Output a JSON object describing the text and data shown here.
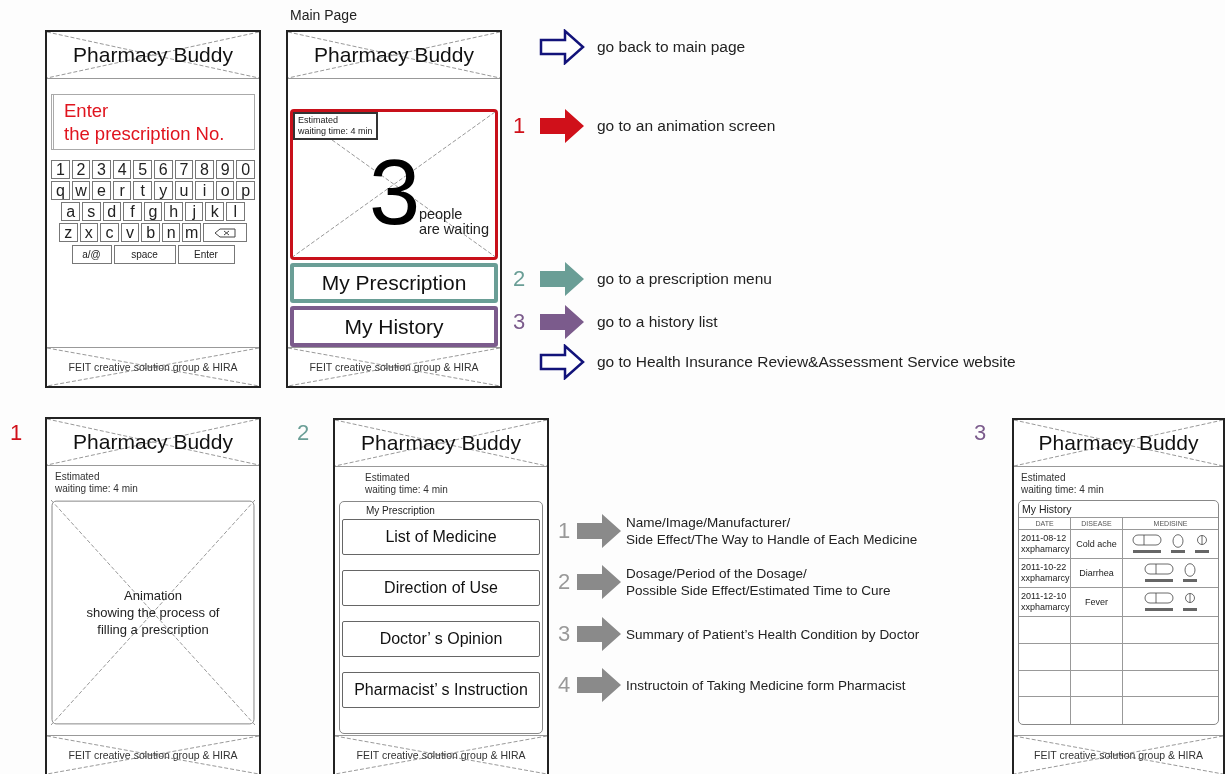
{
  "main_page_label": "Main Page",
  "input_screen": {
    "title": "Pharmacy Buddy",
    "placeholder": "Enter\nthe prescription No.",
    "keyboard": {
      "rows": [
        [
          "1",
          "2",
          "3",
          "4",
          "5",
          "6",
          "7",
          "8",
          "9",
          "0"
        ],
        [
          "q",
          "w",
          "e",
          "r",
          "t",
          "y",
          "u",
          "i",
          "o",
          "p"
        ],
        [
          "a",
          "s",
          "d",
          "f",
          "g",
          "h",
          "j",
          "k",
          "l"
        ],
        [
          "z",
          "x",
          "c",
          "v",
          "b",
          "n",
          "m"
        ]
      ],
      "backspace": true,
      "function_keys": [
        "a/@",
        "space",
        "Enter"
      ]
    },
    "footer": "FEIT creative solution group & HIRA"
  },
  "main_screen": {
    "title": "Pharmacy Buddy",
    "waiting_badge": "Estimated\nwaiting time: 4 min",
    "people_count": "3",
    "people_label": "people\nare waiting",
    "menu": [
      {
        "label": "My Prescription",
        "color": "#6a9e96"
      },
      {
        "label": "My History",
        "color": "#7b5b8c"
      }
    ],
    "footer": "FEIT creative solution group & HIRA"
  },
  "transitions": [
    {
      "kind": "outline",
      "text": "go back to main page"
    },
    {
      "kind": "filled",
      "number": "1",
      "color": "#d0101a",
      "text": "go to an animation screen"
    },
    {
      "kind": "filled",
      "number": "2",
      "color": "#6a9e96",
      "text": "go to a prescription menu"
    },
    {
      "kind": "filled",
      "number": "3",
      "color": "#7b5b8c",
      "text": "go to a history list"
    },
    {
      "kind": "outline",
      "text": "go to Health Insurance Review&Assessment Service website"
    }
  ],
  "section_markers": [
    {
      "label": "1",
      "color": "#d0101a"
    },
    {
      "label": "2",
      "color": "#6a9e96"
    },
    {
      "label": "3",
      "color": "#7b5b8c"
    }
  ],
  "animation_screen": {
    "title": "Pharmacy Buddy",
    "waiting": "Estimated\nwaiting time: 4 min",
    "animation_caption": "Animation\nshowing the process of\nfilling a prescription",
    "footer": "FEIT creative solution group & HIRA"
  },
  "prescription_screen": {
    "title": "Pharmacy Buddy",
    "waiting": "Estimated\nwaiting time: 4 min",
    "section_label": "My Prescription",
    "buttons": [
      "List of Medicine",
      "Direction of Use",
      "Doctor’ s Opinion",
      "Pharmacist’ s Instruction"
    ],
    "footer": "FEIT creative solution group & HIRA"
  },
  "prescription_notes": [
    {
      "number": "1",
      "text": "Name/Image/Manufacturer/\nSide Effect/The Way to Handle of Each Medicine"
    },
    {
      "number": "2",
      "text": "Dosage/Period of the Dosage/\nPossible Side Effect/Estimated Time to Cure"
    },
    {
      "number": "3",
      "text": "Summary of Patient’s Health Condition by Doctor"
    },
    {
      "number": "4",
      "text": "Instructoin of Taking Medicine form Pharmacist"
    }
  ],
  "history_screen": {
    "title": "Pharmacy Buddy",
    "waiting": "Estimated\nwaiting time: 4 min",
    "section_label": "My History",
    "columns": [
      "DATE",
      "DISEASE",
      "MEDISINE"
    ],
    "rows": [
      {
        "date": "2011-08-12",
        "pharmacy": "xxphamarcy",
        "disease": "Cold ache",
        "medicines": [
          {
            "kind": "capsule"
          },
          {
            "kind": "oval"
          },
          {
            "kind": "round"
          }
        ]
      },
      {
        "date": "2011-10-22",
        "pharmacy": "xxphamarcy",
        "disease": "Diarrhea",
        "medicines": [
          {
            "kind": "capsule"
          },
          {
            "kind": "oval"
          }
        ]
      },
      {
        "date": "2011-12-10",
        "pharmacy": "xxphamarcy",
        "disease": "Fever",
        "medicines": [
          {
            "kind": "capsule"
          },
          {
            "kind": "round"
          }
        ]
      }
    ],
    "footer": "FEIT creative solution group & HIRA"
  }
}
